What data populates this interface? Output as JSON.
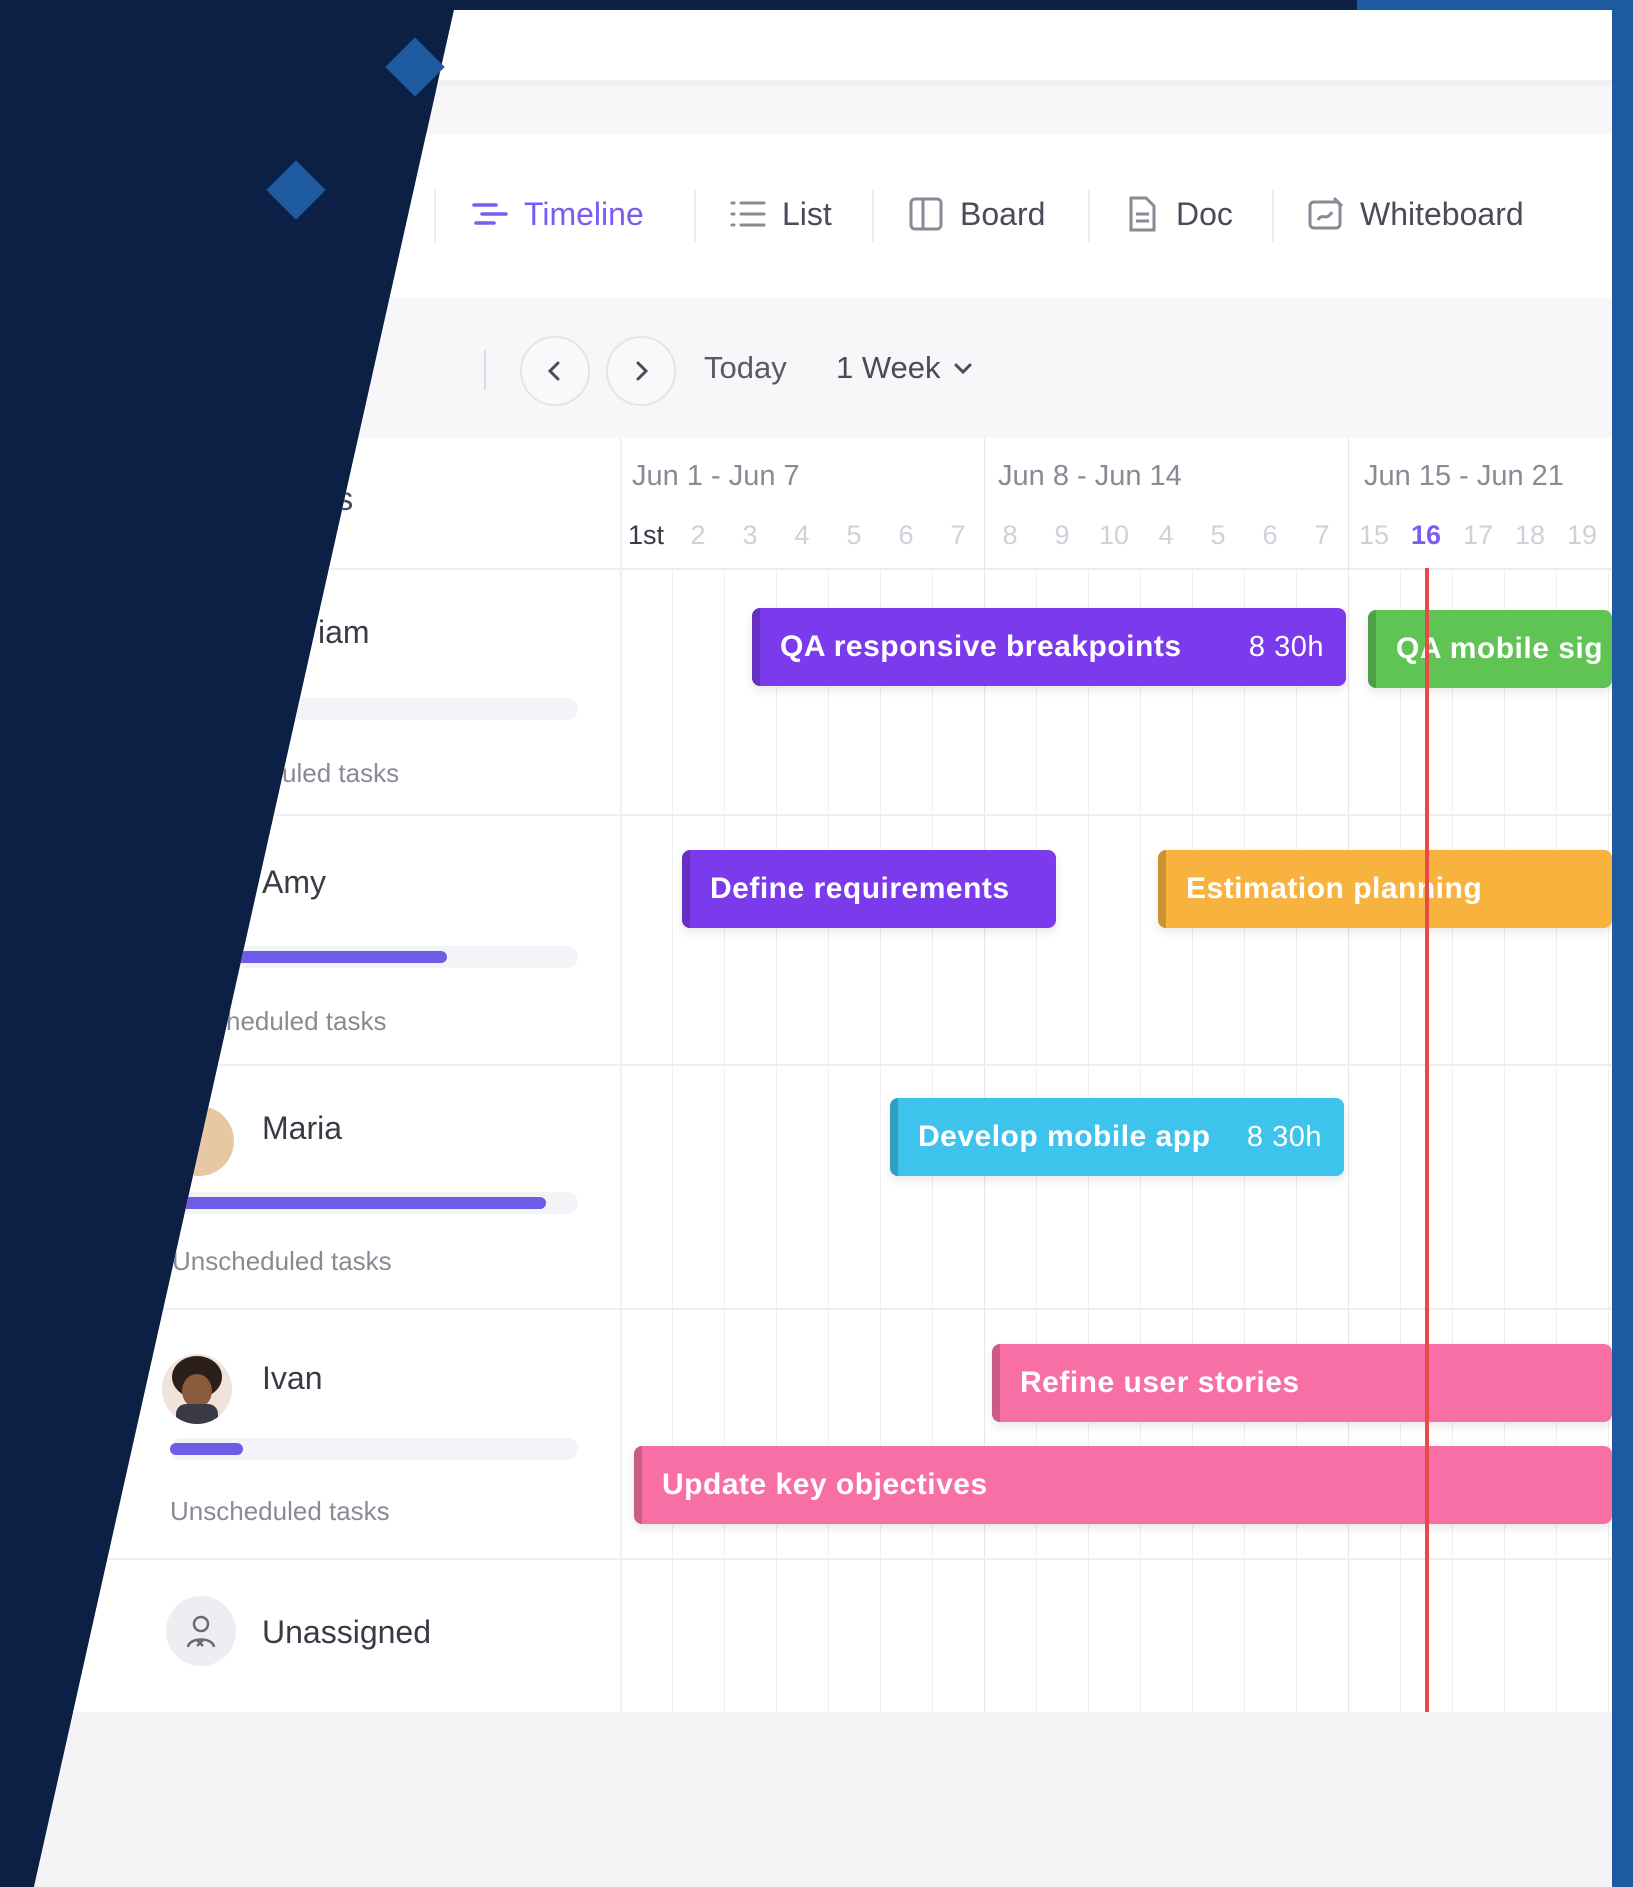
{
  "tabs": [
    {
      "label": "Timeline",
      "icon": "timeline-icon",
      "active": true
    },
    {
      "label": "List",
      "icon": "list-icon",
      "active": false
    },
    {
      "label": "Board",
      "icon": "board-icon",
      "active": false
    },
    {
      "label": "Doc",
      "icon": "doc-icon",
      "active": false
    },
    {
      "label": "Whiteboard",
      "icon": "whiteboard-icon",
      "active": false
    }
  ],
  "toolbar": {
    "prev_icon": "chevron-left-icon",
    "next_icon": "chevron-right-icon",
    "today_label": "Today",
    "range_label": "1 Week"
  },
  "timeline": {
    "column_header": "ees",
    "weeks": [
      "Jun 1 - Jun 7",
      "Jun 8 - Jun 14",
      "Jun 15 - Jun 21"
    ],
    "days": [
      "1st",
      "2",
      "3",
      "4",
      "5",
      "6",
      "7",
      "8",
      "9",
      "10",
      "4",
      "5",
      "6",
      "7",
      "15",
      "16",
      "17",
      "18",
      "19"
    ],
    "today_day": "16"
  },
  "people": [
    {
      "name": "iam",
      "progress": 0.0,
      "unscheduled": "uled tasks"
    },
    {
      "name": "Amy",
      "progress": 0.62,
      "unscheduled": "heduled tasks"
    },
    {
      "name": "Maria",
      "progress": 0.92,
      "unscheduled": "Unscheduled tasks"
    },
    {
      "name": "Ivan",
      "progress": 0.18,
      "unscheduled": "Unscheduled tasks"
    },
    {
      "name": "Unassigned",
      "progress": null,
      "unscheduled": ""
    }
  ],
  "tasks": [
    {
      "label": "QA responsive breakpoints",
      "hours": "8 30h",
      "color": "#7c3aed"
    },
    {
      "label": "QA mobile sig",
      "hours": "",
      "color": "#5fc453"
    },
    {
      "label": "Define requirements",
      "hours": "",
      "color": "#7c3aed"
    },
    {
      "label": "Estimation planning",
      "hours": "",
      "color": "#f8b23e"
    },
    {
      "label": "Develop mobile app",
      "hours": "8 30h",
      "color": "#3ec3ec"
    },
    {
      "label": "Refine user stories",
      "hours": "",
      "color": "#f76fa5"
    },
    {
      "label": "Update key objectives",
      "hours": "",
      "color": "#f76fa5"
    }
  ],
  "colors": {
    "accent": "#7b5cf0",
    "today_line": "#e84a4a",
    "background_navy": "#0c1f44",
    "background_blue": "#1d5a9f"
  }
}
